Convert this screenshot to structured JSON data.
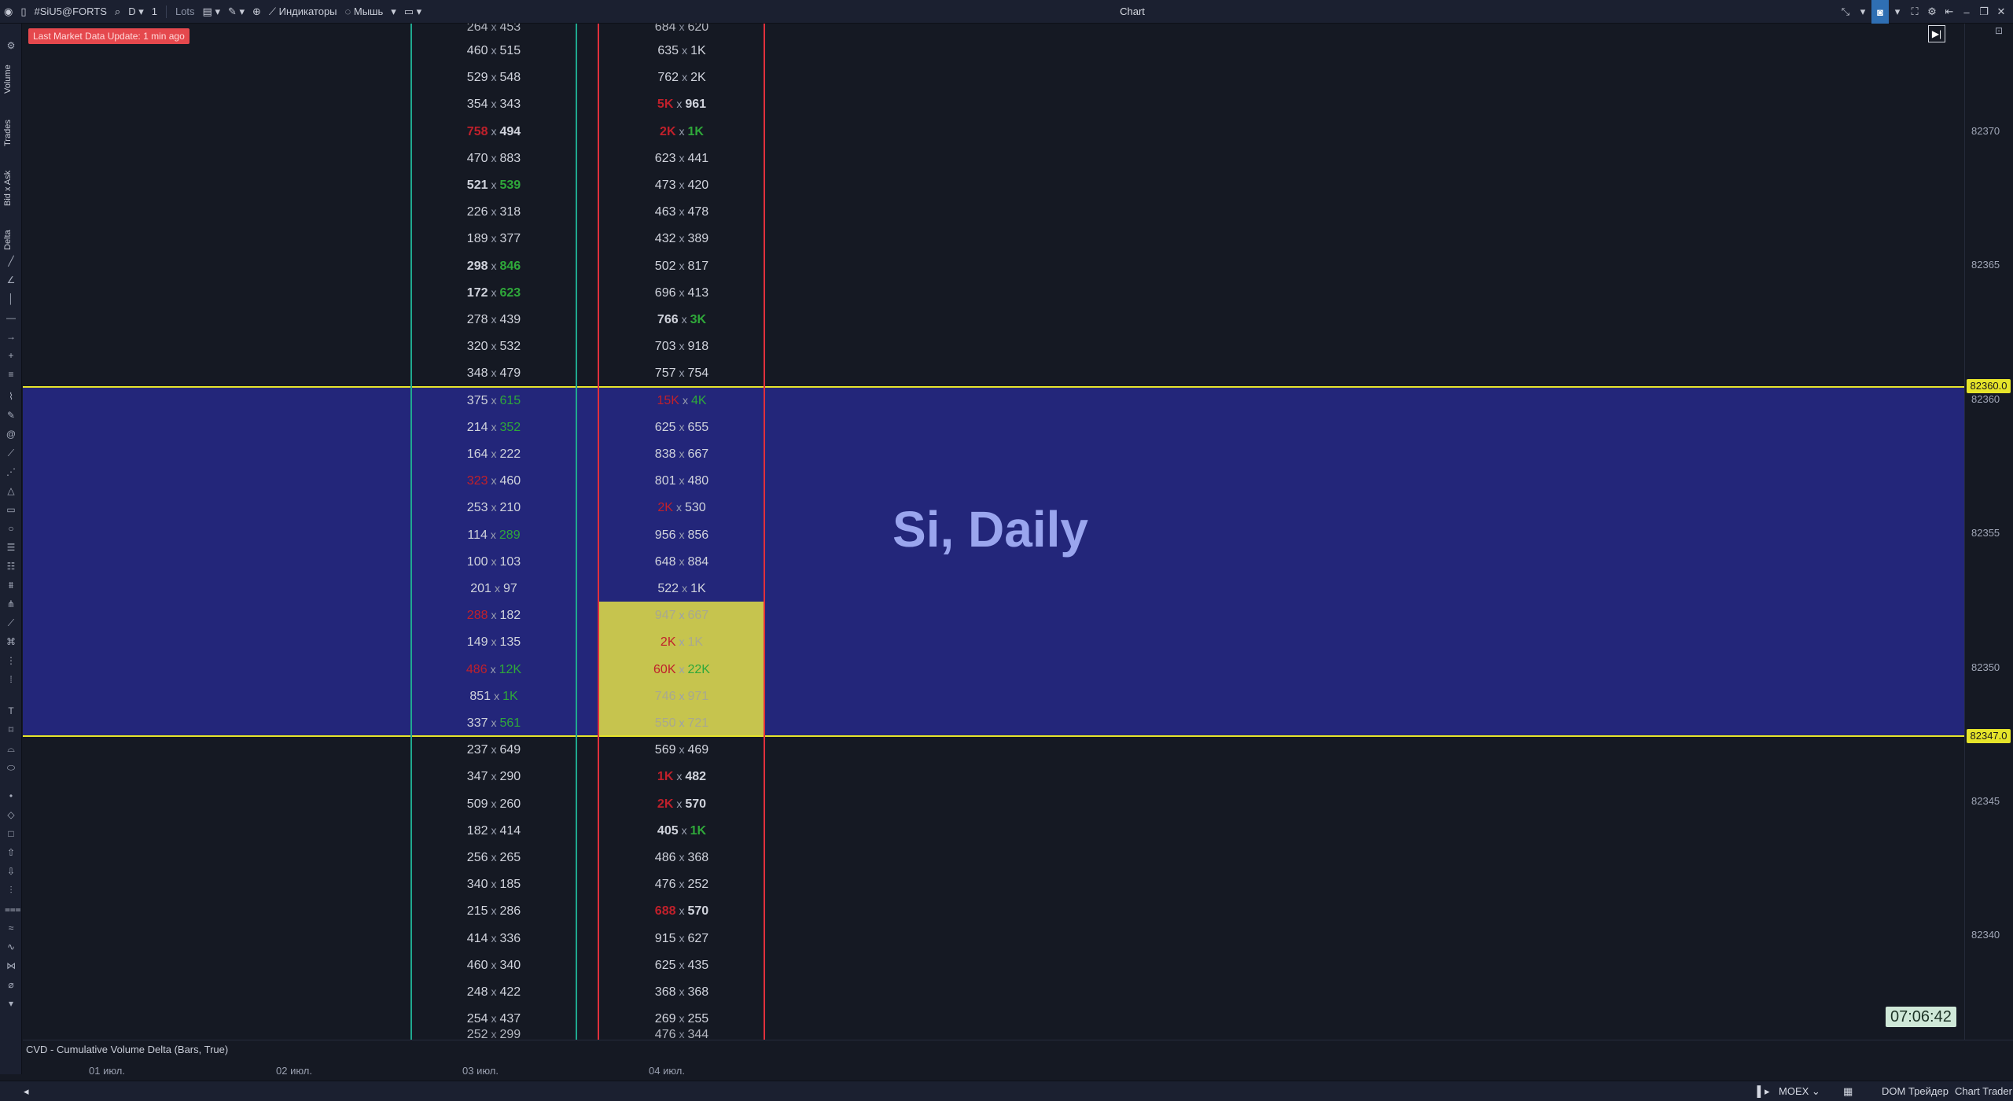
{
  "toolbar": {
    "symbol": "#SiU5@FORTS",
    "timeframe": "D",
    "multiplier": "1",
    "lots_label": "Lots",
    "indicators_label": "Индикаторы",
    "mouse_label": "Мышь"
  },
  "window": {
    "title": "Chart"
  },
  "side_tabs": [
    "Volume",
    "Trades",
    "Bid x Ask",
    "Delta"
  ],
  "badge": {
    "text": "Last Market Data Update: 1 min ago"
  },
  "watermark": "Si, Daily",
  "clock": "07:06:42",
  "price_axis": {
    "ticks": [
      "82370",
      "82365",
      "82360",
      "82355",
      "82350",
      "82345",
      "82340"
    ],
    "tags": [
      "82360.0",
      "82347.0"
    ]
  },
  "colors": {
    "zone": "#23267a",
    "poc": "#c6c44e",
    "level_line": "#e6e42a",
    "sell": "#c0202b",
    "buy": "#2fa83a",
    "neutral": "#d0d3dc",
    "line_teal": "#1fa88f",
    "line_red": "#e0303c"
  },
  "footprint": {
    "top_partial": {
      "left": [
        "264",
        "453"
      ],
      "right": [
        "684",
        "620"
      ]
    },
    "bottom_partial": {
      "left": [
        "252",
        "299"
      ],
      "right": [
        "476",
        "344"
      ]
    },
    "rows": [
      {
        "left": [
          "460",
          "515"
        ],
        "lc": [
          "n",
          "n"
        ],
        "right": [
          "635",
          "1K"
        ],
        "rc": [
          "n",
          "n"
        ]
      },
      {
        "left": [
          "529",
          "548"
        ],
        "lc": [
          "n",
          "n"
        ],
        "right": [
          "762",
          "2K"
        ],
        "rc": [
          "n",
          "n"
        ]
      },
      {
        "left": [
          "354",
          "343"
        ],
        "lc": [
          "n",
          "n"
        ],
        "right": [
          "5K",
          "961"
        ],
        "rc": [
          "s",
          "n"
        ]
      },
      {
        "left": [
          "758",
          "494"
        ],
        "lc": [
          "s",
          "n"
        ],
        "right": [
          "2K",
          "1K"
        ],
        "rc": [
          "s",
          "b"
        ]
      },
      {
        "left": [
          "470",
          "883"
        ],
        "lc": [
          "n",
          "n"
        ],
        "right": [
          "623",
          "441"
        ],
        "rc": [
          "n",
          "n"
        ]
      },
      {
        "left": [
          "521",
          "539"
        ],
        "lc": [
          "n",
          "b"
        ],
        "right": [
          "473",
          "420"
        ],
        "rc": [
          "n",
          "n"
        ]
      },
      {
        "left": [
          "226",
          "318"
        ],
        "lc": [
          "n",
          "n"
        ],
        "right": [
          "463",
          "478"
        ],
        "rc": [
          "n",
          "n"
        ]
      },
      {
        "left": [
          "189",
          "377"
        ],
        "lc": [
          "n",
          "n"
        ],
        "right": [
          "432",
          "389"
        ],
        "rc": [
          "n",
          "n"
        ]
      },
      {
        "left": [
          "298",
          "846"
        ],
        "lc": [
          "n",
          "b"
        ],
        "right": [
          "502",
          "817"
        ],
        "rc": [
          "n",
          "n"
        ]
      },
      {
        "left": [
          "172",
          "623"
        ],
        "lc": [
          "n",
          "b"
        ],
        "right": [
          "696",
          "413"
        ],
        "rc": [
          "n",
          "n"
        ]
      },
      {
        "left": [
          "278",
          "439"
        ],
        "lc": [
          "n",
          "n"
        ],
        "right": [
          "766",
          "3K"
        ],
        "rc": [
          "n",
          "b"
        ]
      },
      {
        "left": [
          "320",
          "532"
        ],
        "lc": [
          "n",
          "n"
        ],
        "right": [
          "703",
          "918"
        ],
        "rc": [
          "n",
          "n"
        ]
      },
      {
        "left": [
          "348",
          "479"
        ],
        "lc": [
          "n",
          "n"
        ],
        "right": [
          "757",
          "754"
        ],
        "rc": [
          "n",
          "n"
        ]
      },
      {
        "left": [
          "375",
          "615"
        ],
        "lc": [
          "n",
          "b"
        ],
        "right": [
          "15K",
          "4K"
        ],
        "rc": [
          "s",
          "b"
        ]
      },
      {
        "left": [
          "214",
          "352"
        ],
        "lc": [
          "n",
          "b"
        ],
        "right": [
          "625",
          "655"
        ],
        "rc": [
          "n",
          "n"
        ]
      },
      {
        "left": [
          "164",
          "222"
        ],
        "lc": [
          "n",
          "n"
        ],
        "right": [
          "838",
          "667"
        ],
        "rc": [
          "n",
          "n"
        ]
      },
      {
        "left": [
          "323",
          "460"
        ],
        "lc": [
          "s",
          "n"
        ],
        "right": [
          "801",
          "480"
        ],
        "rc": [
          "n",
          "n"
        ]
      },
      {
        "left": [
          "253",
          "210"
        ],
        "lc": [
          "n",
          "n"
        ],
        "right": [
          "2K",
          "530"
        ],
        "rc": [
          "s",
          "n"
        ]
      },
      {
        "left": [
          "114",
          "289"
        ],
        "lc": [
          "n",
          "b"
        ],
        "right": [
          "956",
          "856"
        ],
        "rc": [
          "n",
          "n"
        ]
      },
      {
        "left": [
          "100",
          "103"
        ],
        "lc": [
          "n",
          "n"
        ],
        "right": [
          "648",
          "884"
        ],
        "rc": [
          "n",
          "n"
        ]
      },
      {
        "left": [
          "201",
          "97"
        ],
        "lc": [
          "n",
          "n"
        ],
        "right": [
          "522",
          "1K"
        ],
        "rc": [
          "n",
          "n"
        ]
      },
      {
        "left": [
          "288",
          "182"
        ],
        "lc": [
          "s",
          "n"
        ],
        "right": [
          "947",
          "667"
        ],
        "rc": [
          "p",
          "p"
        ]
      },
      {
        "left": [
          "149",
          "135"
        ],
        "lc": [
          "n",
          "n"
        ],
        "right": [
          "2K",
          "1K"
        ],
        "rc": [
          "s",
          "p"
        ]
      },
      {
        "left": [
          "486",
          "12K"
        ],
        "lc": [
          "s",
          "b"
        ],
        "right": [
          "60K",
          "22K"
        ],
        "rc": [
          "s",
          "b"
        ]
      },
      {
        "left": [
          "851",
          "1K"
        ],
        "lc": [
          "n",
          "b"
        ],
        "right": [
          "746",
          "971"
        ],
        "rc": [
          "p",
          "p"
        ]
      },
      {
        "left": [
          "337",
          "561"
        ],
        "lc": [
          "n",
          "b"
        ],
        "right": [
          "550",
          "721"
        ],
        "rc": [
          "p",
          "p"
        ]
      },
      {
        "left": [
          "237",
          "649"
        ],
        "lc": [
          "n",
          "n"
        ],
        "right": [
          "569",
          "469"
        ],
        "rc": [
          "n",
          "n"
        ]
      },
      {
        "left": [
          "347",
          "290"
        ],
        "lc": [
          "n",
          "n"
        ],
        "right": [
          "1K",
          "482"
        ],
        "rc": [
          "s",
          "n"
        ]
      },
      {
        "left": [
          "509",
          "260"
        ],
        "lc": [
          "n",
          "n"
        ],
        "right": [
          "2K",
          "570"
        ],
        "rc": [
          "s",
          "n"
        ]
      },
      {
        "left": [
          "182",
          "414"
        ],
        "lc": [
          "n",
          "n"
        ],
        "right": [
          "405",
          "1K"
        ],
        "rc": [
          "n",
          "b"
        ]
      },
      {
        "left": [
          "256",
          "265"
        ],
        "lc": [
          "n",
          "n"
        ],
        "right": [
          "486",
          "368"
        ],
        "rc": [
          "n",
          "n"
        ]
      },
      {
        "left": [
          "340",
          "185"
        ],
        "lc": [
          "n",
          "n"
        ],
        "right": [
          "476",
          "252"
        ],
        "rc": [
          "n",
          "n"
        ]
      },
      {
        "left": [
          "215",
          "286"
        ],
        "lc": [
          "n",
          "n"
        ],
        "right": [
          "688",
          "570"
        ],
        "rc": [
          "s",
          "n"
        ]
      },
      {
        "left": [
          "414",
          "336"
        ],
        "lc": [
          "n",
          "n"
        ],
        "right": [
          "915",
          "627"
        ],
        "rc": [
          "n",
          "n"
        ]
      },
      {
        "left": [
          "460",
          "340"
        ],
        "lc": [
          "n",
          "n"
        ],
        "right": [
          "625",
          "435"
        ],
        "rc": [
          "n",
          "n"
        ]
      },
      {
        "left": [
          "248",
          "422"
        ],
        "lc": [
          "n",
          "n"
        ],
        "right": [
          "368",
          "368"
        ],
        "rc": [
          "n",
          "n"
        ]
      },
      {
        "left": [
          "254",
          "437"
        ],
        "lc": [
          "n",
          "n"
        ],
        "right": [
          "269",
          "255"
        ],
        "rc": [
          "n",
          "n"
        ]
      }
    ]
  },
  "indicator": {
    "label": "CVD - Cumulative Volume Delta (Bars, True)"
  },
  "dates": [
    "01 июл.",
    "02 июл.",
    "03 июл.",
    "04 июл."
  ],
  "statusbar": {
    "exchange": "MOEX",
    "dom_label": "DOM Трейдер",
    "chart_trader_label": "Chart Trader"
  }
}
